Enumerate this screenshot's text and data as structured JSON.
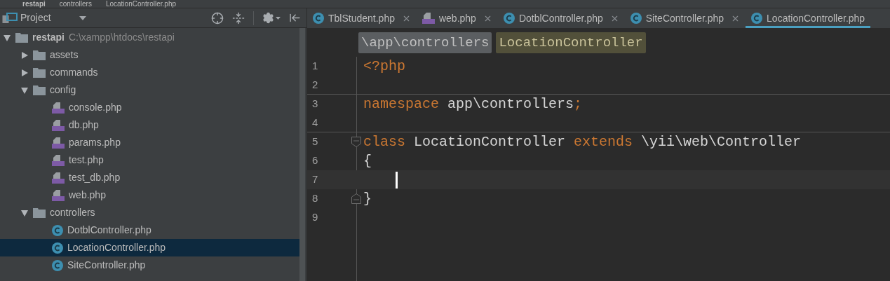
{
  "breadcrumbs": [
    "restapi",
    "controllers",
    "LocationController.php"
  ],
  "project_panel": {
    "title": "Project"
  },
  "tree": [
    {
      "kind": "folder",
      "label": "restapi",
      "path": "C:\\xampp\\htdocs\\restapi",
      "expanded": true,
      "selected": false,
      "children": [
        {
          "kind": "folder",
          "label": "assets",
          "expanded": false,
          "selected": false
        },
        {
          "kind": "folder",
          "label": "commands",
          "expanded": false,
          "selected": false
        },
        {
          "kind": "folder",
          "label": "config",
          "expanded": true,
          "selected": false,
          "children": [
            {
              "kind": "php",
              "label": "console.php",
              "selected": false
            },
            {
              "kind": "php",
              "label": "db.php",
              "selected": false
            },
            {
              "kind": "php",
              "label": "params.php",
              "selected": false
            },
            {
              "kind": "php",
              "label": "test.php",
              "selected": false
            },
            {
              "kind": "php",
              "label": "test_db.php",
              "selected": false
            },
            {
              "kind": "php",
              "label": "web.php",
              "selected": false
            }
          ]
        },
        {
          "kind": "folder",
          "label": "controllers",
          "expanded": true,
          "selected": false,
          "children": [
            {
              "kind": "class",
              "label": "DotblController.php",
              "selected": false
            },
            {
              "kind": "class",
              "label": "LocationController.php",
              "selected": true
            },
            {
              "kind": "class",
              "label": "SiteController.php",
              "selected": false
            }
          ]
        }
      ]
    }
  ],
  "tabs": [
    {
      "kind": "class",
      "label": "TblStudent.php",
      "selected": false
    },
    {
      "kind": "php",
      "label": "web.php",
      "selected": false
    },
    {
      "kind": "class",
      "label": "DotblController.php",
      "selected": false
    },
    {
      "kind": "class",
      "label": "SiteController.php",
      "selected": false
    },
    {
      "kind": "class",
      "label": "LocationController.php",
      "selected": true
    }
  ],
  "editor_breadcrumbs": [
    {
      "kind": "namespace",
      "text": "\\app\\controllers"
    },
    {
      "kind": "class",
      "text": "LocationController"
    }
  ],
  "code_lines": [
    {
      "number": "1",
      "kind": "plain",
      "current": false,
      "separator_below": false,
      "tokens": [
        {
          "kind": "keyword",
          "text": "<?php"
        }
      ]
    },
    {
      "number": "2",
      "kind": "plain",
      "current": false,
      "separator_below": true
    },
    {
      "number": "3",
      "kind": "plain",
      "current": false,
      "separator_below": false,
      "tokens": [
        {
          "kind": "keyword",
          "text": "namespace"
        },
        {
          "kind": "plain",
          "text": " app\\controllers"
        },
        {
          "kind": "keyword",
          "text": ";"
        }
      ]
    },
    {
      "number": "4",
      "kind": "plain",
      "current": false,
      "separator_below": true
    },
    {
      "number": "5",
      "kind": "fold_start",
      "current": false,
      "separator_below": false,
      "tokens": [
        {
          "kind": "keyword",
          "text": "class"
        },
        {
          "kind": "plain",
          "text": " LocationController "
        },
        {
          "kind": "keyword",
          "text": "extends"
        },
        {
          "kind": "plain",
          "text": " \\yii\\web\\Controller"
        }
      ]
    },
    {
      "number": "6",
      "kind": "plain",
      "current": false,
      "separator_below": false,
      "tokens": [
        {
          "kind": "plain",
          "text": "{"
        }
      ]
    },
    {
      "number": "7",
      "kind": "plain",
      "current": true,
      "separator_below": false
    },
    {
      "number": "8",
      "kind": "fold_end",
      "current": false,
      "separator_below": false,
      "tokens": [
        {
          "kind": "plain",
          "text": "}"
        }
      ]
    },
    {
      "number": "9",
      "kind": "plain",
      "current": false,
      "separator_below": false
    }
  ]
}
